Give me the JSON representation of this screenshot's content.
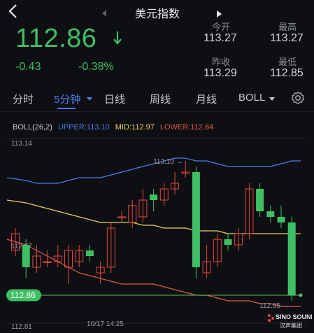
{
  "header": {
    "title": "美元指数",
    "back_icon": "back-icon",
    "prev_icon": "prev-arrow-icon",
    "next_icon": "next-arrow-icon"
  },
  "quote": {
    "price": "112.86",
    "direction_icon": "down-arrow-icon",
    "change": "-0.43",
    "change_pct": "-0.38%",
    "open_label": "今开",
    "open": "113.27",
    "high_label": "最高",
    "high": "113.27",
    "prev_close_label": "昨收",
    "prev_close": "113.29",
    "low_label": "最低",
    "low": "112.85",
    "colors": {
      "down": "#3fbf63",
      "up": "#e2483f"
    }
  },
  "tabs": [
    {
      "label": "分时",
      "active": false
    },
    {
      "label": "5分钟",
      "active": true,
      "dropdown": true
    },
    {
      "label": "日线",
      "active": false
    },
    {
      "label": "周线",
      "active": false
    },
    {
      "label": "月线",
      "active": false
    },
    {
      "label": "BOLL",
      "active": false,
      "dropdown": true
    }
  ],
  "settings_icon": "gear-icon",
  "indicator": {
    "name": "BOLL(26,2)",
    "upper_label": "UPPER:113.10",
    "mid_label": "MID:112.97",
    "lower_label": "LOWER:112.84",
    "colors": {
      "upper": "#4a7ee8",
      "mid": "#e8d25a",
      "lower": "#e05a4a",
      "price_line": "#5fbf5f"
    }
  },
  "chart_data": {
    "type": "candlestick",
    "interval": "5分钟",
    "y_tick_labels": [
      "113.14",
      "112.97",
      "112.81"
    ],
    "ylim": [
      112.81,
      113.14
    ],
    "x_tick_labels": [
      "10/17 14:25"
    ],
    "current_price_label": "112.86",
    "max_label": "113.10",
    "min_label": "112.85",
    "candles": [
      {
        "open": 112.94,
        "close": 112.97,
        "high": 112.98,
        "low": 112.93
      },
      {
        "open": 112.95,
        "close": 112.91,
        "high": 112.96,
        "low": 112.89
      },
      {
        "open": 112.91,
        "close": 112.93,
        "high": 112.95,
        "low": 112.9
      },
      {
        "open": 112.92,
        "close": 112.92,
        "high": 112.94,
        "low": 112.91
      },
      {
        "open": 112.92,
        "close": 112.93,
        "high": 112.95,
        "low": 112.91
      },
      {
        "open": 112.91,
        "close": 112.94,
        "high": 112.95,
        "low": 112.88
      },
      {
        "open": 112.92,
        "close": 112.94,
        "high": 112.95,
        "low": 112.91
      },
      {
        "open": 112.94,
        "close": 112.93,
        "high": 112.95,
        "low": 112.92
      },
      {
        "open": 112.9,
        "close": 112.91,
        "high": 112.92,
        "low": 112.88
      },
      {
        "open": 112.91,
        "close": 112.98,
        "high": 112.99,
        "low": 112.9
      },
      {
        "open": 113.0,
        "close": 113.0,
        "high": 113.01,
        "low": 112.99
      },
      {
        "open": 112.99,
        "close": 113.02,
        "high": 113.03,
        "low": 112.98
      },
      {
        "open": 113.0,
        "close": 113.03,
        "high": 113.05,
        "low": 112.99
      },
      {
        "open": 113.04,
        "close": 113.03,
        "high": 113.05,
        "low": 113.01
      },
      {
        "open": 113.03,
        "close": 113.05,
        "high": 113.06,
        "low": 113.02
      },
      {
        "open": 113.05,
        "close": 113.06,
        "high": 113.08,
        "low": 113.04
      },
      {
        "open": 113.08,
        "close": 113.08,
        "high": 113.1,
        "low": 113.07
      },
      {
        "open": 113.08,
        "close": 112.91,
        "high": 113.09,
        "low": 112.89
      },
      {
        "open": 112.9,
        "close": 112.92,
        "high": 112.95,
        "low": 112.89
      },
      {
        "open": 112.92,
        "close": 112.96,
        "high": 112.97,
        "low": 112.91
      },
      {
        "open": 112.96,
        "close": 112.95,
        "high": 112.97,
        "low": 112.94
      },
      {
        "open": 112.95,
        "close": 112.97,
        "high": 112.98,
        "low": 112.94
      },
      {
        "open": 112.97,
        "close": 113.05,
        "high": 113.06,
        "low": 112.96
      },
      {
        "open": 113.05,
        "close": 113.01,
        "high": 113.06,
        "low": 113.0
      },
      {
        "open": 113.01,
        "close": 113.0,
        "high": 113.02,
        "low": 112.99
      },
      {
        "open": 113.0,
        "close": 112.99,
        "high": 113.02,
        "low": 112.98
      },
      {
        "open": 112.99,
        "close": 112.86,
        "high": 113.0,
        "low": 112.85
      }
    ],
    "boll_upper": [
      113.07,
      113.065,
      113.06,
      113.06,
      113.06,
      113.065,
      113.07,
      113.07,
      113.07,
      113.075,
      113.08,
      113.085,
      113.09,
      113.095,
      113.1,
      113.105,
      113.105,
      113.1,
      113.1,
      113.095,
      113.09,
      113.09,
      113.09,
      113.09,
      113.09,
      113.095,
      113.1
    ],
    "boll_mid": [
      113.03,
      113.025,
      113.02,
      113.015,
      113.01,
      113.005,
      113.0,
      112.995,
      112.99,
      112.99,
      112.99,
      112.99,
      112.985,
      112.985,
      112.98,
      112.98,
      112.98,
      112.975,
      112.975,
      112.975,
      112.97,
      112.97,
      112.97,
      112.97,
      112.97,
      112.97,
      112.97
    ],
    "boll_lower": [
      112.96,
      112.95,
      112.94,
      112.93,
      112.92,
      112.91,
      112.9,
      112.895,
      112.89,
      112.885,
      112.88,
      112.88,
      112.88,
      112.88,
      112.875,
      112.87,
      112.865,
      112.86,
      112.86,
      112.855,
      112.85,
      112.85,
      112.85,
      112.845,
      112.845,
      112.84,
      112.84
    ]
  },
  "brand": {
    "name": "SINO SOUND",
    "sub": "汉声集团"
  }
}
